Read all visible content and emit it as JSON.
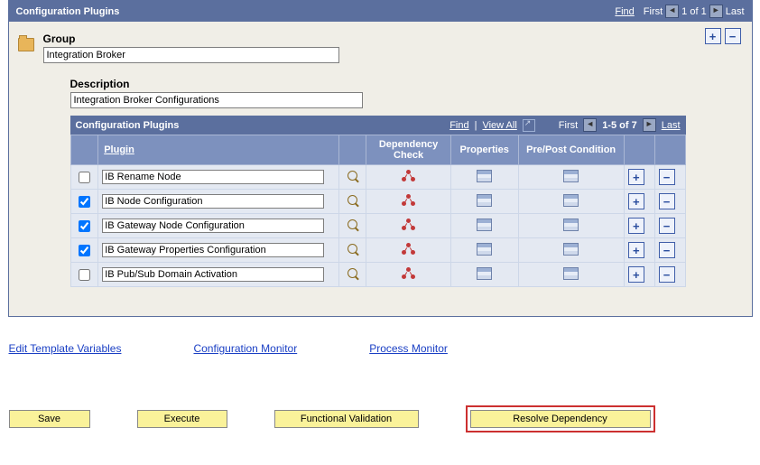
{
  "header": {
    "title": "Configuration Plugins",
    "find": "Find",
    "first": "First",
    "pos": "1 of 1",
    "last": "Last"
  },
  "group": {
    "label": "Group",
    "value": "Integration Broker"
  },
  "description": {
    "label": "Description",
    "value": "Integration Broker Configurations"
  },
  "grid": {
    "title": "Configuration Plugins",
    "find": "Find",
    "viewall": "View All",
    "first": "First",
    "range": "1-5 of 7",
    "last": "Last",
    "cols": {
      "plugin": "Plugin",
      "dep": "Dependency Check",
      "props": "Properties",
      "prepost": "Pre/Post Condition"
    },
    "rows": [
      {
        "checked": false,
        "name": "IB Rename Node"
      },
      {
        "checked": true,
        "name": "IB Node Configuration"
      },
      {
        "checked": true,
        "name": "IB Gateway Node Configuration"
      },
      {
        "checked": true,
        "name": "IB Gateway Properties Configuration"
      },
      {
        "checked": false,
        "name": "IB Pub/Sub Domain Activation"
      }
    ]
  },
  "links": {
    "edit_vars": "Edit Template Variables",
    "config_mon": "Configuration Monitor",
    "proc_mon": "Process Monitor"
  },
  "buttons": {
    "save": "Save",
    "execute": "Execute",
    "functional": "Functional Validation",
    "resolve": "Resolve Dependency"
  }
}
